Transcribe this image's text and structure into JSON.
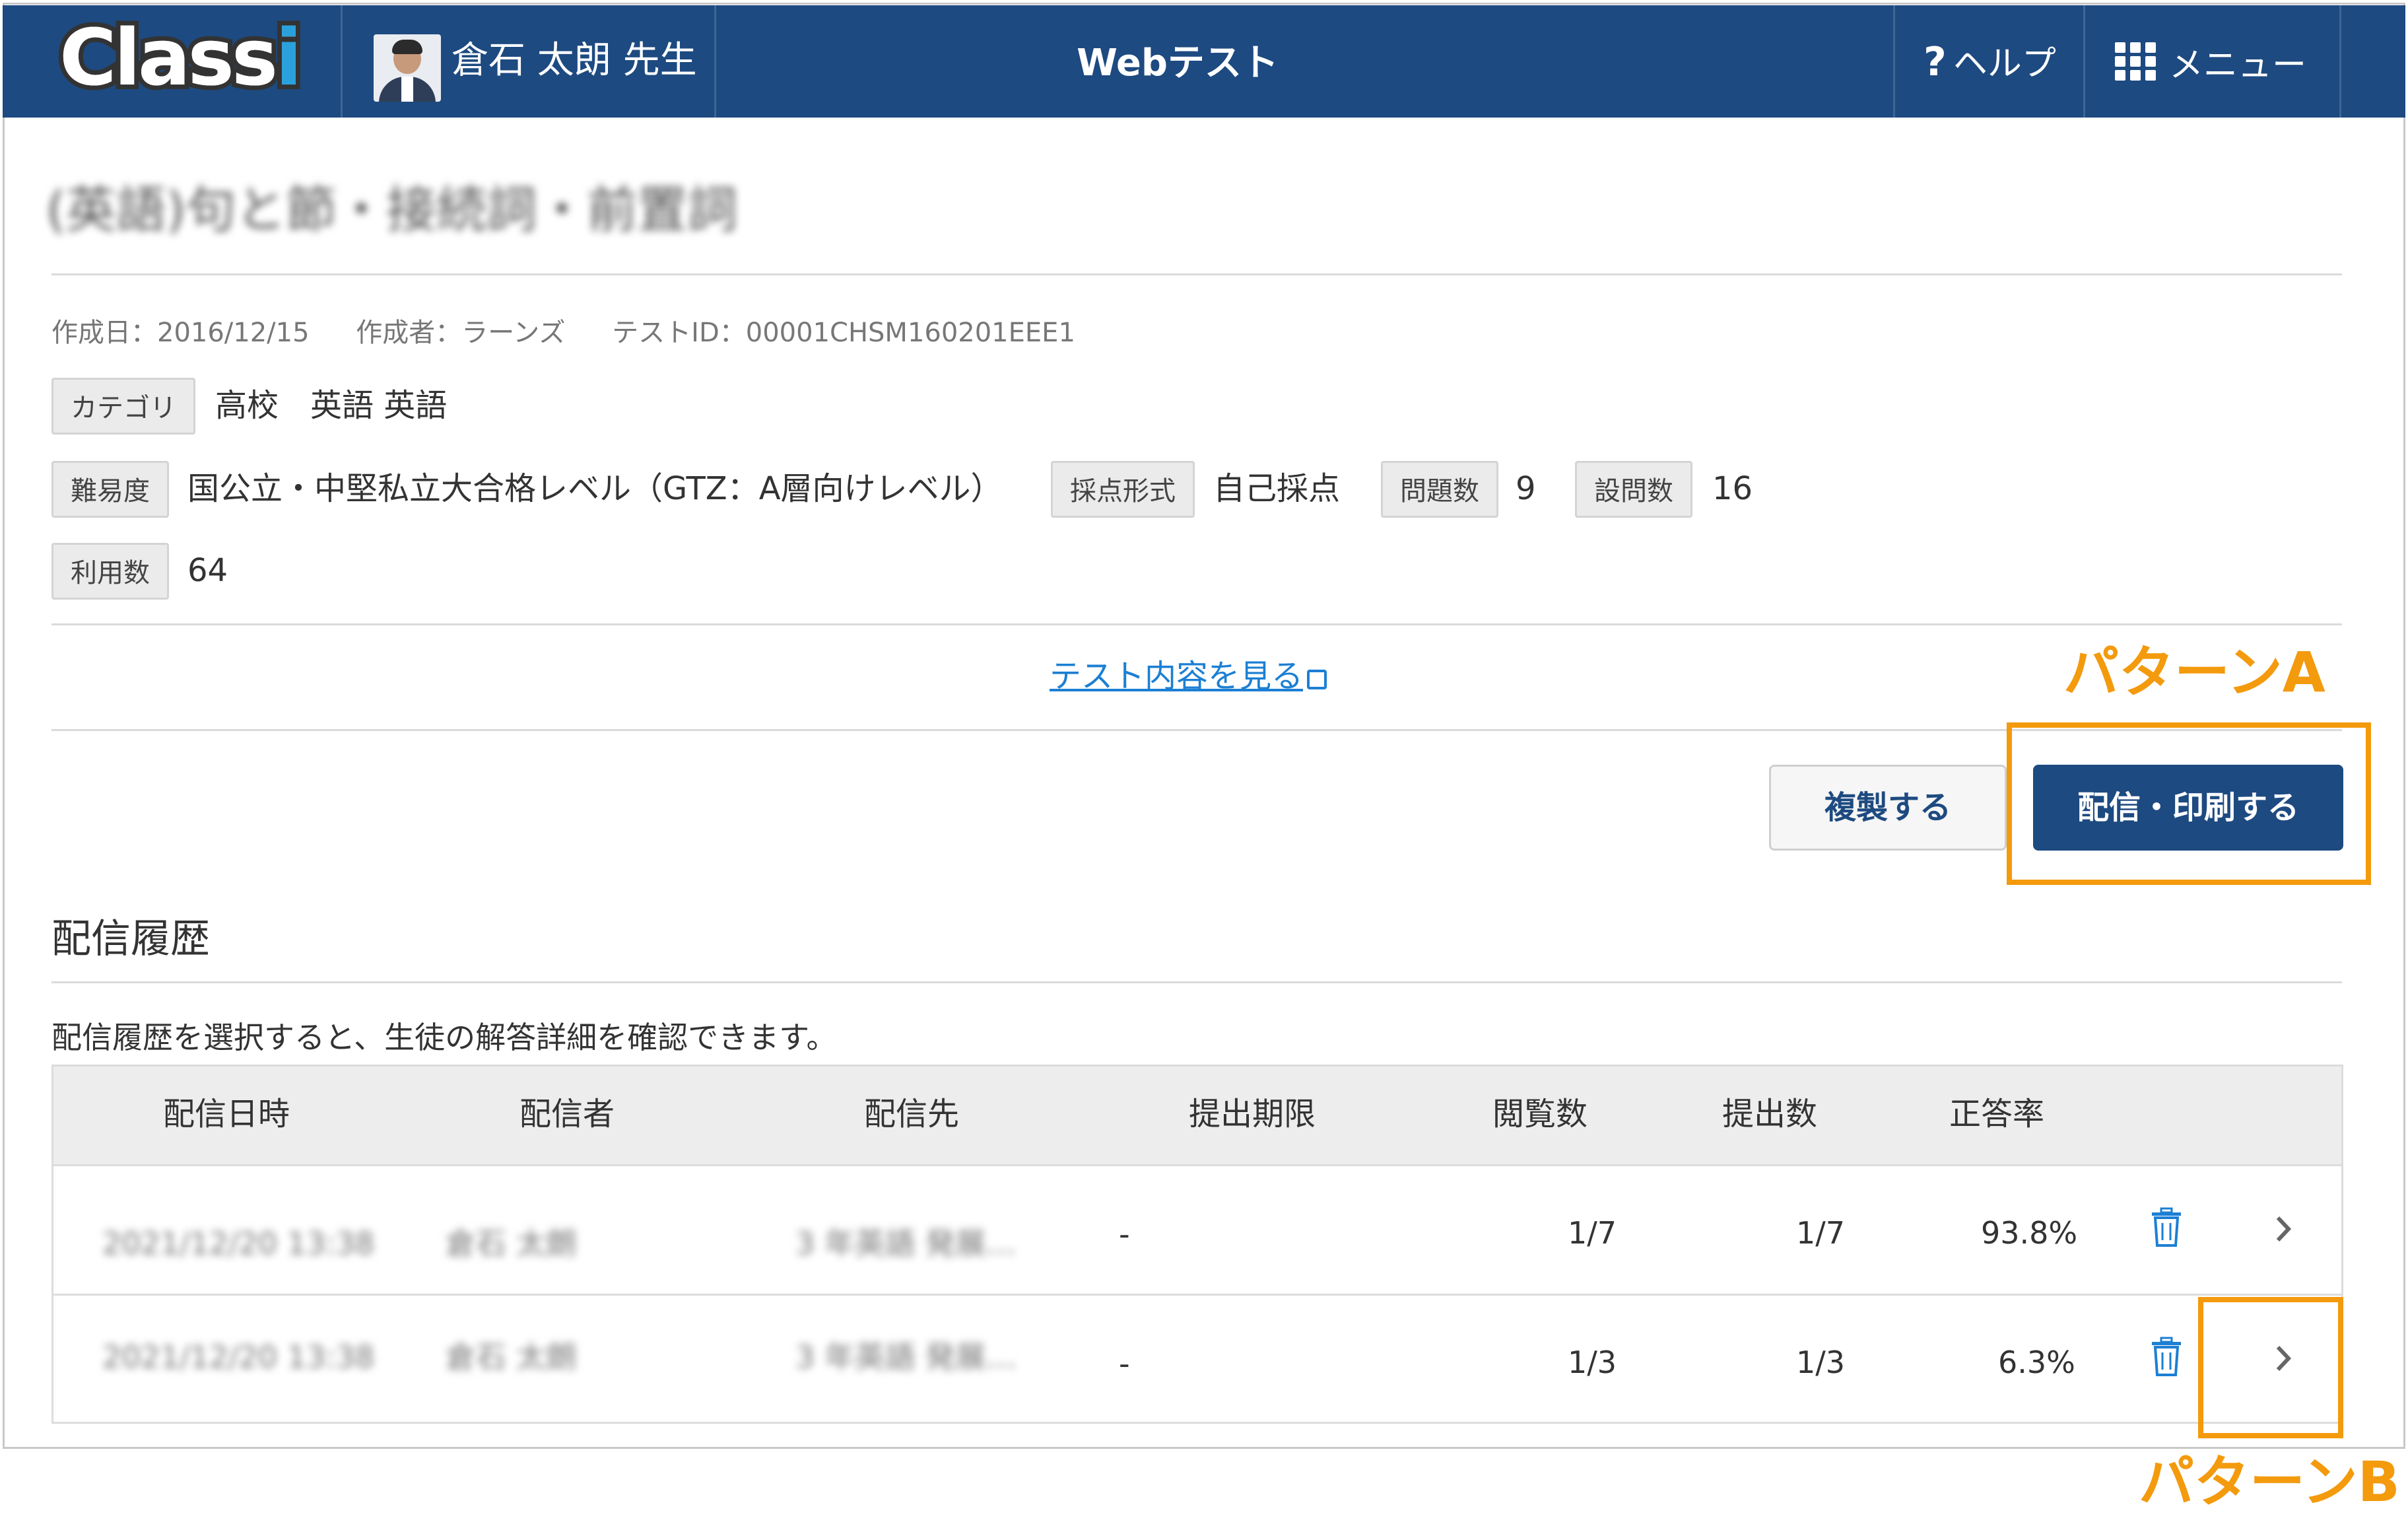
{
  "header": {
    "logo": "Class",
    "logo_i": "i",
    "teacher_name": "倉石 太朗 先生",
    "title": "Webテスト",
    "help_label": "ヘルプ",
    "help_glyph": "?",
    "menu_label": "メニュー"
  },
  "test": {
    "title": "(英語)句と節・接続詞・前置詞",
    "created_date": "作成日：2016/12/15",
    "creator": "作成者：ラーンズ",
    "test_id": "テストID：00001CHSM160201EEE1",
    "category_tag": "カテゴリ",
    "category_value": "高校　英語 英語",
    "difficulty_tag": "難易度",
    "difficulty_value": "国公立・中堅私立大合格レベル（GTZ：A層向けレベル）",
    "grading_tag": "採点形式",
    "grading_value": "自己採点",
    "questions_tag": "問題数",
    "questions_value": "9",
    "items_tag": "設問数",
    "items_value": "16",
    "usage_tag": "利用数",
    "usage_value": "64"
  },
  "actions": {
    "view_content_link": "テスト内容を見る",
    "copy_button": "複製する",
    "send_print_button": "配信・印刷する"
  },
  "annotations": {
    "pattern_a": "パターンA",
    "pattern_b": "パターンB",
    "highlight_color": "#f39a0d"
  },
  "history": {
    "section_title": "配信履歴",
    "note": "配信履歴を選択すると、生徒の解答詳細を確認できます。",
    "columns": [
      "配信日時",
      "配信者",
      "配信先",
      "提出期限",
      "閲覧数",
      "提出数",
      "正答率"
    ],
    "rows": [
      {
        "datetime": "2021/12/20 13:38",
        "sender": "倉石 太朗",
        "destination": "3 年英語 発展…",
        "deadline": "-",
        "views": "1/7",
        "submissions": "1/7",
        "accuracy": "93.8%"
      },
      {
        "datetime": "2021/12/20 13:38",
        "sender": "倉石 太朗",
        "destination": "3 年英語 発展…",
        "deadline": "-",
        "views": "1/3",
        "submissions": "1/3",
        "accuracy": "6.3%"
      }
    ]
  },
  "colors": {
    "header_bg": "#1d4a80",
    "link": "#1c7fd3",
    "trash": "#1c7fd3"
  }
}
